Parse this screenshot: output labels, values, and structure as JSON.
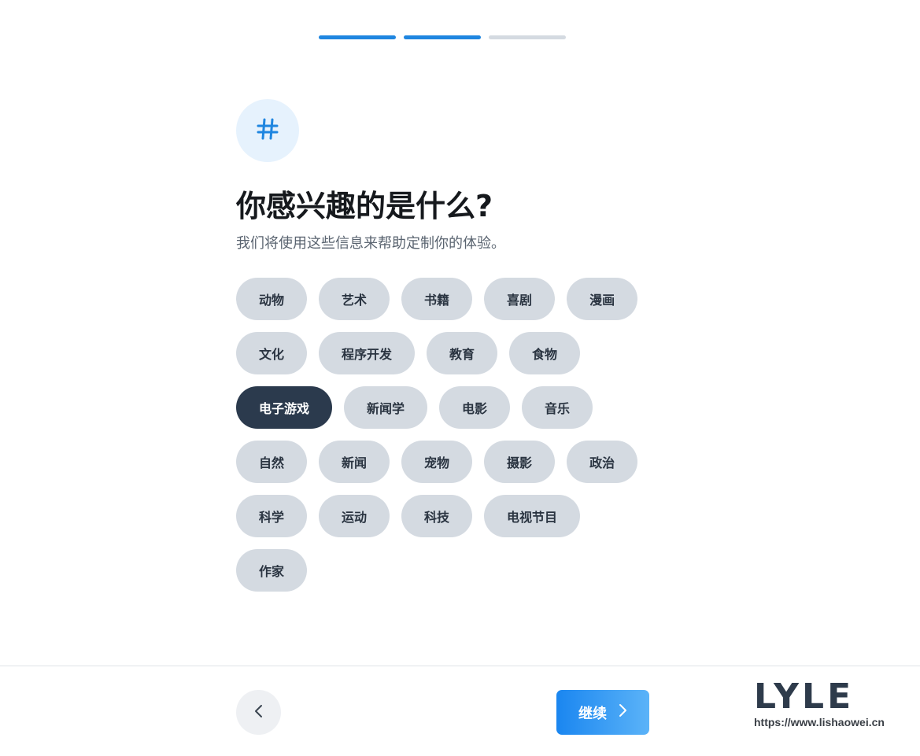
{
  "progress": {
    "steps": [
      {
        "active": true
      },
      {
        "active": true
      },
      {
        "active": false
      }
    ],
    "active_color": "#1f86e0",
    "inactive_color": "#d4dae1"
  },
  "header": {
    "icon": "hash-icon",
    "title": "你感兴趣的是什么?",
    "subtitle": "我们将使用这些信息来帮助定制你的体验。"
  },
  "interests": {
    "rows": [
      [
        {
          "label": "动物",
          "selected": false
        },
        {
          "label": "艺术",
          "selected": false
        },
        {
          "label": "书籍",
          "selected": false
        },
        {
          "label": "喜剧",
          "selected": false
        },
        {
          "label": "漫画",
          "selected": false
        }
      ],
      [
        {
          "label": "文化",
          "selected": false
        },
        {
          "label": "程序开发",
          "selected": false
        },
        {
          "label": "教育",
          "selected": false
        },
        {
          "label": "食物",
          "selected": false
        }
      ],
      [
        {
          "label": "电子游戏",
          "selected": true
        },
        {
          "label": "新闻学",
          "selected": false
        },
        {
          "label": "电影",
          "selected": false
        },
        {
          "label": "音乐",
          "selected": false
        }
      ],
      [
        {
          "label": "自然",
          "selected": false
        },
        {
          "label": "新闻",
          "selected": false
        },
        {
          "label": "宠物",
          "selected": false
        },
        {
          "label": "摄影",
          "selected": false
        },
        {
          "label": "政治",
          "selected": false
        }
      ],
      [
        {
          "label": "科学",
          "selected": false
        },
        {
          "label": "运动",
          "selected": false
        },
        {
          "label": "科技",
          "selected": false
        },
        {
          "label": "电视节目",
          "selected": false
        }
      ],
      [
        {
          "label": "作家",
          "selected": false
        }
      ]
    ],
    "chip_color": "#d4dae1",
    "selected_color": "#2b3a4d"
  },
  "footer": {
    "back_icon": "chevron-left-icon",
    "continue_label": "继续",
    "continue_icon": "chevron-right-icon"
  },
  "watermark": {
    "logo_text": "LYLE",
    "url": "https://www.lishaowei.cn"
  }
}
